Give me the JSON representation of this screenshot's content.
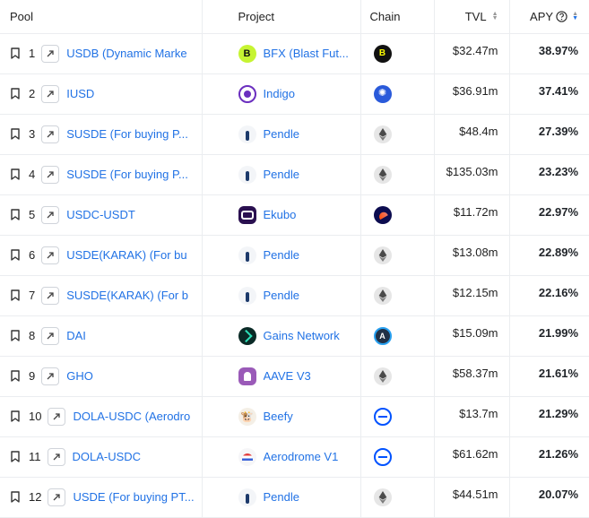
{
  "header": {
    "pool": "Pool",
    "project": "Project",
    "chain": "Chain",
    "tvl": "TVL",
    "apy": "APY",
    "info_icon": "question-circle-icon",
    "sort_icon": "sort-icon"
  },
  "colors": {
    "link": "#2172e5",
    "border": "#ebedf0"
  },
  "rows": [
    {
      "rank": "1",
      "pool": "USDB (Dynamic Marke",
      "project": "BFX (Blast Fut...",
      "project_icon": "bfx-logo",
      "chain_icon": "blast-chain",
      "tvl": "$32.47m",
      "apy": "38.97%"
    },
    {
      "rank": "2",
      "pool": "IUSD",
      "project": "Indigo",
      "project_icon": "indigo-logo",
      "chain_icon": "cardano-chain",
      "tvl": "$36.91m",
      "apy": "37.41%"
    },
    {
      "rank": "3",
      "pool": "SUSDE (For buying P...",
      "project": "Pendle",
      "project_icon": "pendle-logo",
      "chain_icon": "ethereum-chain",
      "tvl": "$48.4m",
      "apy": "27.39%"
    },
    {
      "rank": "4",
      "pool": "SUSDE (For buying P...",
      "project": "Pendle",
      "project_icon": "pendle-logo",
      "chain_icon": "ethereum-chain",
      "tvl": "$135.03m",
      "apy": "23.23%"
    },
    {
      "rank": "5",
      "pool": "USDC-USDT",
      "project": "Ekubo",
      "project_icon": "ekubo-logo",
      "chain_icon": "starknet-chain",
      "tvl": "$11.72m",
      "apy": "22.97%"
    },
    {
      "rank": "6",
      "pool": "USDE(KARAK) (For bu",
      "project": "Pendle",
      "project_icon": "pendle-logo",
      "chain_icon": "ethereum-chain",
      "tvl": "$13.08m",
      "apy": "22.89%"
    },
    {
      "rank": "7",
      "pool": "SUSDE(KARAK) (For b",
      "project": "Pendle",
      "project_icon": "pendle-logo",
      "chain_icon": "ethereum-chain",
      "tvl": "$12.15m",
      "apy": "22.16%"
    },
    {
      "rank": "8",
      "pool": "DAI",
      "project": "Gains Network",
      "project_icon": "gains-logo",
      "chain_icon": "arbitrum-chain",
      "tvl": "$15.09m",
      "apy": "21.99%"
    },
    {
      "rank": "9",
      "pool": "GHO",
      "project": "AAVE V3",
      "project_icon": "aave-logo",
      "chain_icon": "ethereum-chain",
      "tvl": "$58.37m",
      "apy": "21.61%"
    },
    {
      "rank": "10",
      "pool": "DOLA-USDC (Aerodro",
      "project": "Beefy",
      "project_icon": "beefy-logo",
      "chain_icon": "base-chain",
      "tvl": "$13.7m",
      "apy": "21.29%"
    },
    {
      "rank": "11",
      "pool": "DOLA-USDC",
      "project": "Aerodrome V1",
      "project_icon": "aerodrome-logo",
      "chain_icon": "base-chain",
      "tvl": "$61.62m",
      "apy": "21.26%"
    },
    {
      "rank": "12",
      "pool": "USDE (For buying PT...",
      "project": "Pendle",
      "project_icon": "pendle-logo",
      "chain_icon": "ethereum-chain",
      "tvl": "$44.51m",
      "apy": "20.07%"
    }
  ]
}
